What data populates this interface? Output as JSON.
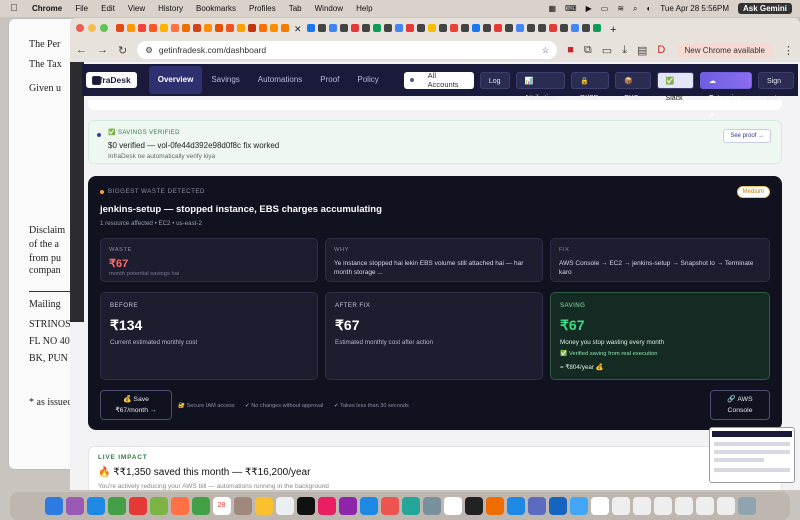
{
  "menubar": {
    "app": "Chrome",
    "items": [
      "File",
      "Edit",
      "View",
      "History",
      "Bookmarks",
      "Profiles",
      "Tab",
      "Window",
      "Help"
    ],
    "datetime": "Tue Apr 28  5:56PM",
    "gemini": "Ask Gemini"
  },
  "background_doc": {
    "lines": [
      "The Per",
      "The Tax",
      "Given u",
      "Disclaim",
      "of the a",
      "from pu",
      "compan",
      "Mailing",
      "STRINOS",
      "FL NO 40",
      "BK, PUN",
      "* as issued"
    ]
  },
  "browser": {
    "url": "getinfradesk.com/dashboard",
    "new_chrome": "New Chrome available"
  },
  "nav": {
    "logo": "InfraDesk",
    "links": [
      "Overview",
      "Savings",
      "Automations",
      "Proof",
      "Policy"
    ],
    "account": "All Accounts",
    "buttons": {
      "log": "Log",
      "attribution": "📊 Attribution",
      "risp": "🔒 RI/SP",
      "eks": "📦 EKS",
      "slack": "✅ Slack",
      "enterprise": "☁ Enterprise ✦",
      "signout": "Sign out"
    }
  },
  "verified": {
    "label": "✅ SAVINGS VERIFIED",
    "message": "$0 verified — vol-0fe44d392e98d0f8c fix worked",
    "sub": "InfraDesk ne automatically verify kiya",
    "proof": "See proof →"
  },
  "waste": {
    "heading": "BIGGEST WASTE DETECTED",
    "badge": "Medium",
    "title": "jenkins-setup — stopped instance, EBS charges accumulating",
    "meta": "1 resource affected • EC2 • us-east-2",
    "waste_label": "WASTE",
    "waste_value": "₹67",
    "waste_sub": "month potential savings hai",
    "why_label": "WHY",
    "why_text": "Ye instance stopped hai lekin EBS volume still attached hai — har month storage ...",
    "fix_label": "FIX",
    "fix_text": "AWS Console → EC2 → jenkins-setup → Snapshot lo → Terminate karo",
    "before_label": "BEFORE",
    "before_value": "₹134",
    "before_sub": "Current estimated monthly cost",
    "after_label": "AFTER FIX",
    "after_value": "₹67",
    "after_sub": "Estimated monthly cost after action",
    "saving_label": "SAVING",
    "saving_value": "₹67",
    "saving_sub": "Money you stop wasting every month",
    "saving_verified": "✅ Verified saving from real execution",
    "saving_year": "= ₹804/year 💰",
    "save_btn_line1": "💰 Save",
    "save_btn_line2": "₹67/month →",
    "features": [
      "🔐 Secure IAM access",
      "✔ No changes without approval",
      "✔ Takes less than 30 seconds"
    ],
    "aws_btn_line1": "🔗 AWS",
    "aws_btn_line2": "Console"
  },
  "live": {
    "label": "LIVE IMPACT",
    "value": "🔥 ₹₹1,350 saved this month — ₹₹16,200/year",
    "sub": "You're actively reducing your AWS bill — automations running in the background",
    "right": "2 a"
  }
}
